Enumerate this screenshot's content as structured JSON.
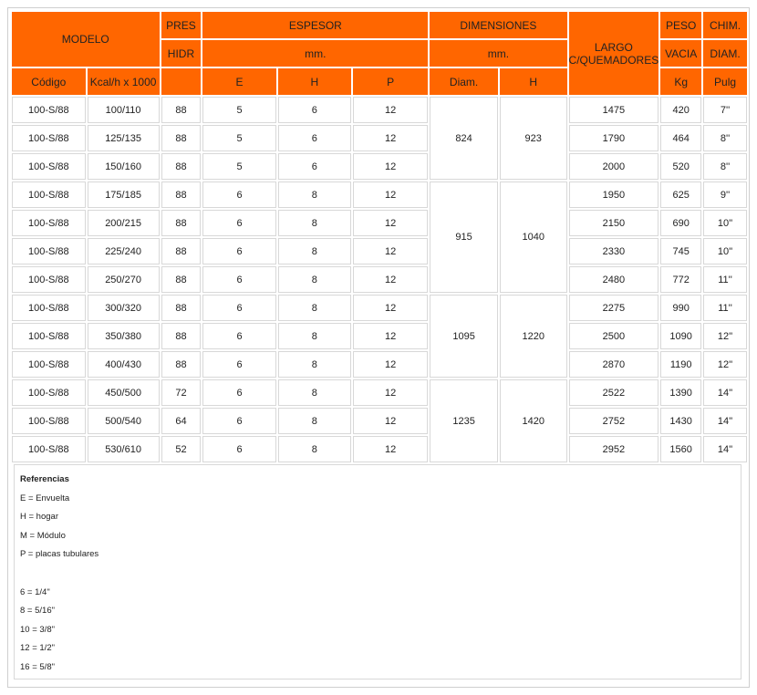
{
  "header": {
    "modelo": "MODELO",
    "pres": "PRES",
    "hidr": "HIDR",
    "espesor": "ESPESOR",
    "espesor_unit": "mm.",
    "dimensiones": "DIMENSIONES",
    "dimensiones_unit": "mm.",
    "largo_line1": "LARGO",
    "largo_line2": "C/QUEMADORES",
    "peso": "PESO",
    "vacia": "VACIA",
    "kg": "Kg",
    "chim": "CHIM.",
    "diam": "DIAM.",
    "pulg": "Pulg",
    "codigo": "Código",
    "kcal": "Kcal/h x 1000",
    "e": "E",
    "h": "H",
    "p": "P",
    "diam_short": "Diam.",
    "h2": "H"
  },
  "groups": [
    {
      "diam": "824",
      "h": "923"
    },
    {
      "diam": "915",
      "h": "1040"
    },
    {
      "diam": "1095",
      "h": "1220"
    },
    {
      "diam": "1235",
      "h": "1420"
    }
  ],
  "rows": [
    {
      "codigo": "100-S/88",
      "kcal": "100/110",
      "pres": "88",
      "e": "5",
      "h": "6",
      "p": "12",
      "largo": "1475",
      "peso": "420",
      "chim": "7''"
    },
    {
      "codigo": "100-S/88",
      "kcal": "125/135",
      "pres": "88",
      "e": "5",
      "h": "6",
      "p": "12",
      "largo": "1790",
      "peso": "464",
      "chim": "8''"
    },
    {
      "codigo": "100-S/88",
      "kcal": "150/160",
      "pres": "88",
      "e": "5",
      "h": "6",
      "p": "12",
      "largo": "2000",
      "peso": "520",
      "chim": "8''"
    },
    {
      "codigo": "100-S/88",
      "kcal": "175/185",
      "pres": "88",
      "e": "6",
      "h": "8",
      "p": "12",
      "largo": "1950",
      "peso": "625",
      "chim": "9''"
    },
    {
      "codigo": "100-S/88",
      "kcal": "200/215",
      "pres": "88",
      "e": "6",
      "h": "8",
      "p": "12",
      "largo": "2150",
      "peso": "690",
      "chim": "10''"
    },
    {
      "codigo": "100-S/88",
      "kcal": "225/240",
      "pres": "88",
      "e": "6",
      "h": "8",
      "p": "12",
      "largo": "2330",
      "peso": "745",
      "chim": "10''"
    },
    {
      "codigo": "100-S/88",
      "kcal": "250/270",
      "pres": "88",
      "e": "6",
      "h": "8",
      "p": "12",
      "largo": "2480",
      "peso": "772",
      "chim": "11''"
    },
    {
      "codigo": "100-S/88",
      "kcal": "300/320",
      "pres": "88",
      "e": "6",
      "h": "8",
      "p": "12",
      "largo": "2275",
      "peso": "990",
      "chim": "11''"
    },
    {
      "codigo": "100-S/88",
      "kcal": "350/380",
      "pres": "88",
      "e": "6",
      "h": "8",
      "p": "12",
      "largo": "2500",
      "peso": "1090",
      "chim": "12''"
    },
    {
      "codigo": "100-S/88",
      "kcal": "400/430",
      "pres": "88",
      "e": "6",
      "h": "8",
      "p": "12",
      "largo": "2870",
      "peso": "1190",
      "chim": "12''"
    },
    {
      "codigo": "100-S/88",
      "kcal": "450/500",
      "pres": "72",
      "e": "6",
      "h": "8",
      "p": "12",
      "largo": "2522",
      "peso": "1390",
      "chim": "14''"
    },
    {
      "codigo": "100-S/88",
      "kcal": "500/540",
      "pres": "64",
      "e": "6",
      "h": "8",
      "p": "12",
      "largo": "2752",
      "peso": "1430",
      "chim": "14''"
    },
    {
      "codigo": "100-S/88",
      "kcal": "530/610",
      "pres": "52",
      "e": "6",
      "h": "8",
      "p": "12",
      "largo": "2952",
      "peso": "1560",
      "chim": "14''"
    }
  ],
  "refs": {
    "title": "Referencias",
    "lines_a": [
      "E = Envuelta",
      "H = hogar",
      "M = Módulo",
      "P = placas tubulares"
    ],
    "lines_b": [
      "6 = 1/4\"",
      "8 = 5/16\"",
      "10 = 3/8\"",
      "12 = 1/2\"",
      "16 = 5/8\""
    ]
  },
  "colors": {
    "header_bg": "#ff6600",
    "border": "#d8d8d8"
  }
}
